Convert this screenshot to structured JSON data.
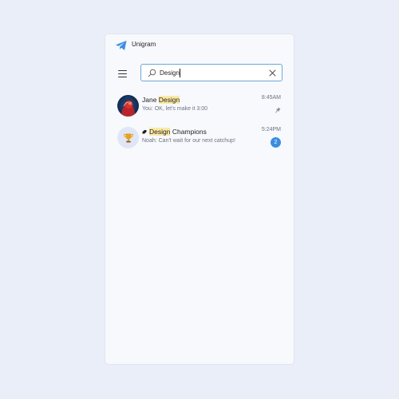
{
  "app": {
    "title": "Unigram",
    "accent_color": "#3c8de0",
    "logo_icon": "telegram-plane-icon"
  },
  "search": {
    "value": "Design",
    "placeholder": "Search",
    "search_icon": "search-icon",
    "clear_icon": "close-icon"
  },
  "menu": {
    "icon": "hamburger-menu-icon"
  },
  "chats": [
    {
      "name_prefix": "Jane ",
      "name_match": "Design",
      "name_suffix": "",
      "preview": "You: OK, let's make it 3:00",
      "time": "8:45AM",
      "pinned": true,
      "avatar": "profile-photo"
    },
    {
      "name_prefix": "",
      "name_match": "Design",
      "name_suffix": " Champions",
      "preview": "Noah: Can't wait for our next catchup!",
      "time": "5:24PM",
      "unread": "2",
      "is_group": true,
      "avatar": "trophy-icon"
    }
  ]
}
